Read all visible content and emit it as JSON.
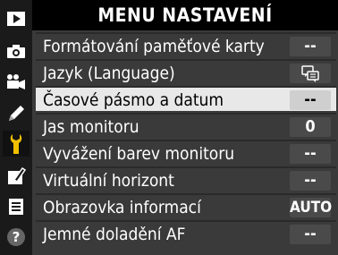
{
  "menu": {
    "title": "MENU NASTAVENÍ",
    "items": [
      {
        "label": "Formátování paměťové karty",
        "value": "--"
      },
      {
        "label": "Jazyk (Language)",
        "value": "",
        "value_icon": "language-icon"
      },
      {
        "label": "Časové pásmo a datum",
        "value": "--"
      },
      {
        "label": "Jas monitoru",
        "value": "0"
      },
      {
        "label": "Vyvážení barev monitoru",
        "value": "--"
      },
      {
        "label": "Virtuální horizont",
        "value": "--"
      },
      {
        "label": "Obrazovka informací",
        "value": "AUTO"
      },
      {
        "label": "Jemné doladění AF",
        "value": "--"
      }
    ],
    "selected_index": 2
  },
  "tabs": [
    {
      "icon": "playback-icon"
    },
    {
      "icon": "camera-icon"
    },
    {
      "icon": "video-icon"
    },
    {
      "icon": "pencil-icon"
    },
    {
      "icon": "wrench-icon",
      "active": true
    },
    {
      "icon": "retouch-icon"
    },
    {
      "icon": "my-menu-icon"
    },
    {
      "icon": "help-icon"
    }
  ],
  "colors": {
    "background": "#000000",
    "list_background": "#3a3a3a",
    "selected_row": "#e8e8e8",
    "active_tab_icon": "#f0c000"
  }
}
